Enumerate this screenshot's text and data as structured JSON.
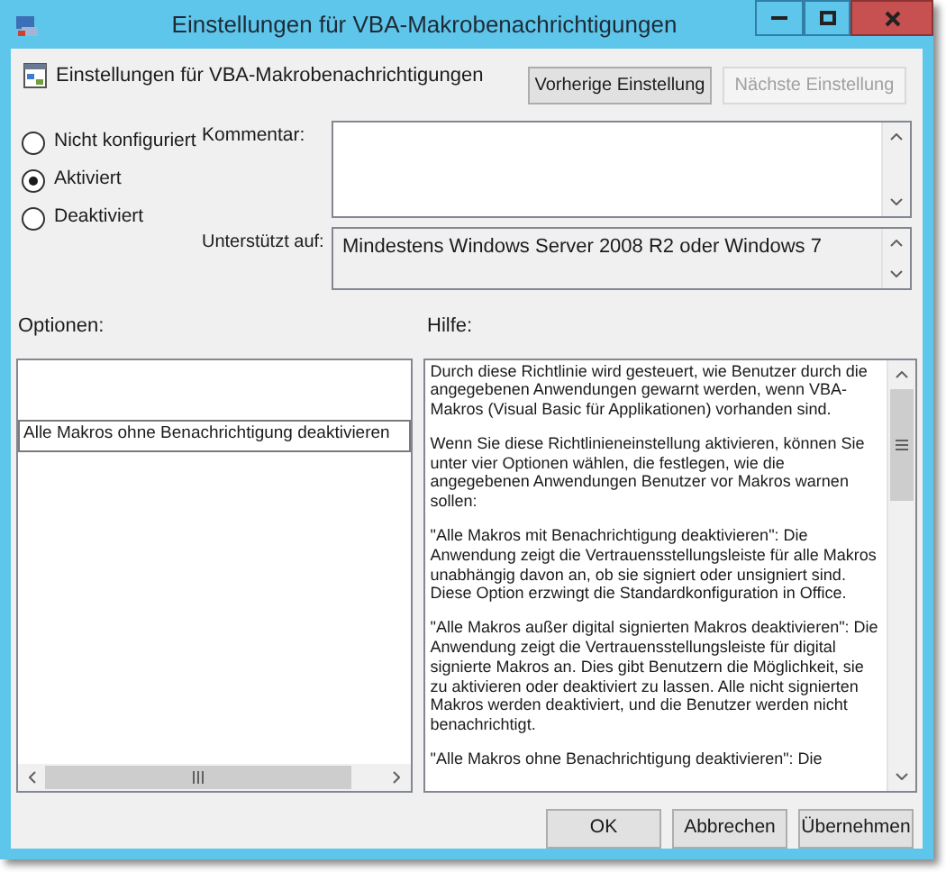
{
  "window": {
    "title": "Einstellungen für VBA-Makrobenachrichtigungen"
  },
  "header": {
    "title": "Einstellungen für VBA-Makrobenachrichtigungen"
  },
  "nav_buttons": [
    {
      "label": "Vorherige Einstellung",
      "disabled": false
    },
    {
      "label": "Nächste Einstellung",
      "disabled": true
    }
  ],
  "state_options": [
    {
      "label": "Nicht konfiguriert",
      "selected": false
    },
    {
      "label": "Aktiviert",
      "selected": true
    },
    {
      "label": "Deaktiviert",
      "selected": false
    }
  ],
  "comment": {
    "label": "Kommentar:"
  },
  "supported_on": {
    "label": "Unterstützt auf:",
    "value": "Mindestens Windows Server 2008 R2 oder Windows 7"
  },
  "options": {
    "label": "Optionen:",
    "items": [
      {
        "text": "Alle Makros ohne Benachrichtigung deaktivieren"
      }
    ]
  },
  "help": {
    "label": "Hilfe:",
    "paragraphs": [
      "Durch diese Richtlinie wird gesteuert, wie Benutzer durch die angegebenen Anwendungen gewarnt werden, wenn VBA-Makros (Visual Basic für Applikationen) vorhanden sind.",
      "Wenn Sie diese Richtlinieneinstellung aktivieren, können Sie unter vier Optionen wählen, die festlegen, wie die angegebenen Anwendungen Benutzer vor Makros warnen sollen:",
      "\"Alle Makros mit Benachrichtigung deaktivieren\": Die Anwendung zeigt die Vertrauensstellungsleiste für alle Makros unabhängig davon an, ob sie signiert oder unsigniert sind. Diese Option erzwingt die Standardkonfiguration in Office.",
      "\"Alle Makros außer digital signierten Makros deaktivieren\": Die Anwendung zeigt die Vertrauensstellungsleiste für digital signierte Makros an. Dies gibt Benutzern die Möglichkeit, sie zu aktivieren oder deaktiviert zu lassen. Alle nicht signierten Makros werden deaktiviert, und die Benutzer werden nicht benachrichtigt.",
      "\"Alle Makros ohne Benachrichtigung deaktivieren\": Die"
    ]
  },
  "buttons": [
    "OK",
    "Abbrechen",
    "Übernehmen"
  ]
}
